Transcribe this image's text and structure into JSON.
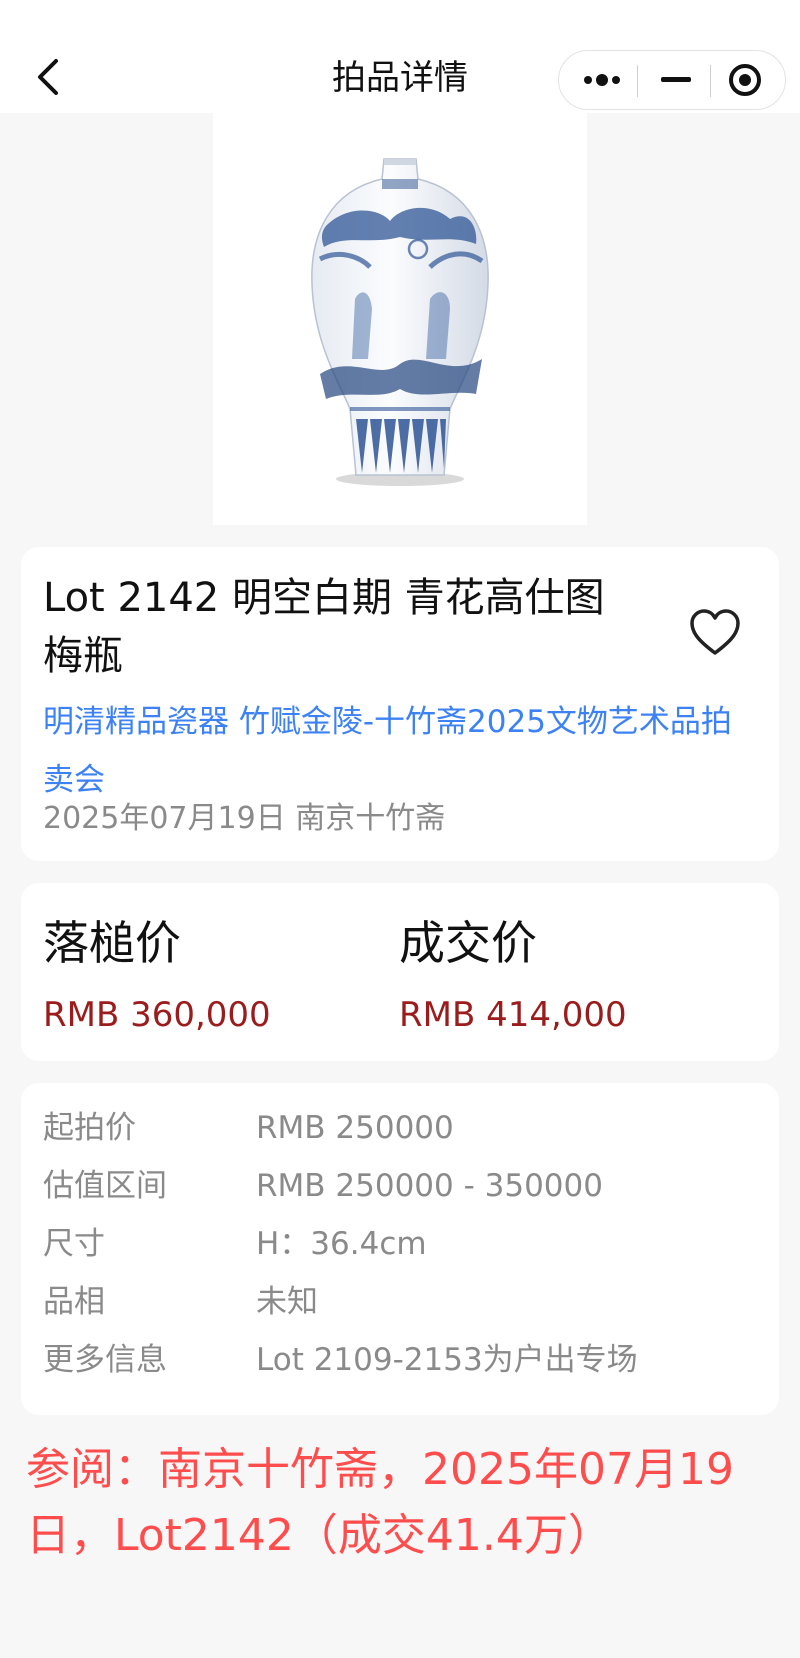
{
  "nav": {
    "title": "拍品详情"
  },
  "lot": {
    "title": "Lot 2142 明空白期 青花高仕图梅瓶",
    "auction": "明清精品瓷器 竹赋金陵-十竹斋2025文物艺术品拍卖会",
    "date_house": "2025年07月19日 南京十竹斋"
  },
  "prices": {
    "hammer_label": "落槌价",
    "hammer_value": "RMB 360,000",
    "final_label": "成交价",
    "final_value": "RMB 414,000"
  },
  "details": [
    {
      "label": "起拍价",
      "value": "RMB 250000"
    },
    {
      "label": "估值区间",
      "value": "RMB 250000 - 350000"
    },
    {
      "label": "尺寸",
      "value": "H：36.4cm"
    },
    {
      "label": "品相",
      "value": "未知"
    },
    {
      "label": "更多信息",
      "value": "Lot 2109-2153为户出专场"
    }
  ],
  "reference": "参阅：南京十竹斋，2025年07月19日，Lot2142（成交41.4万）",
  "colors": {
    "accent_link": "#3d82f4",
    "price_red": "#9b1c1c",
    "reference_red": "#ff4d4d",
    "background": "#f7f7f7"
  },
  "icons": [
    "back-arrow-icon",
    "more-dots-icon",
    "minimize-icon",
    "close-target-icon",
    "heart-icon"
  ]
}
